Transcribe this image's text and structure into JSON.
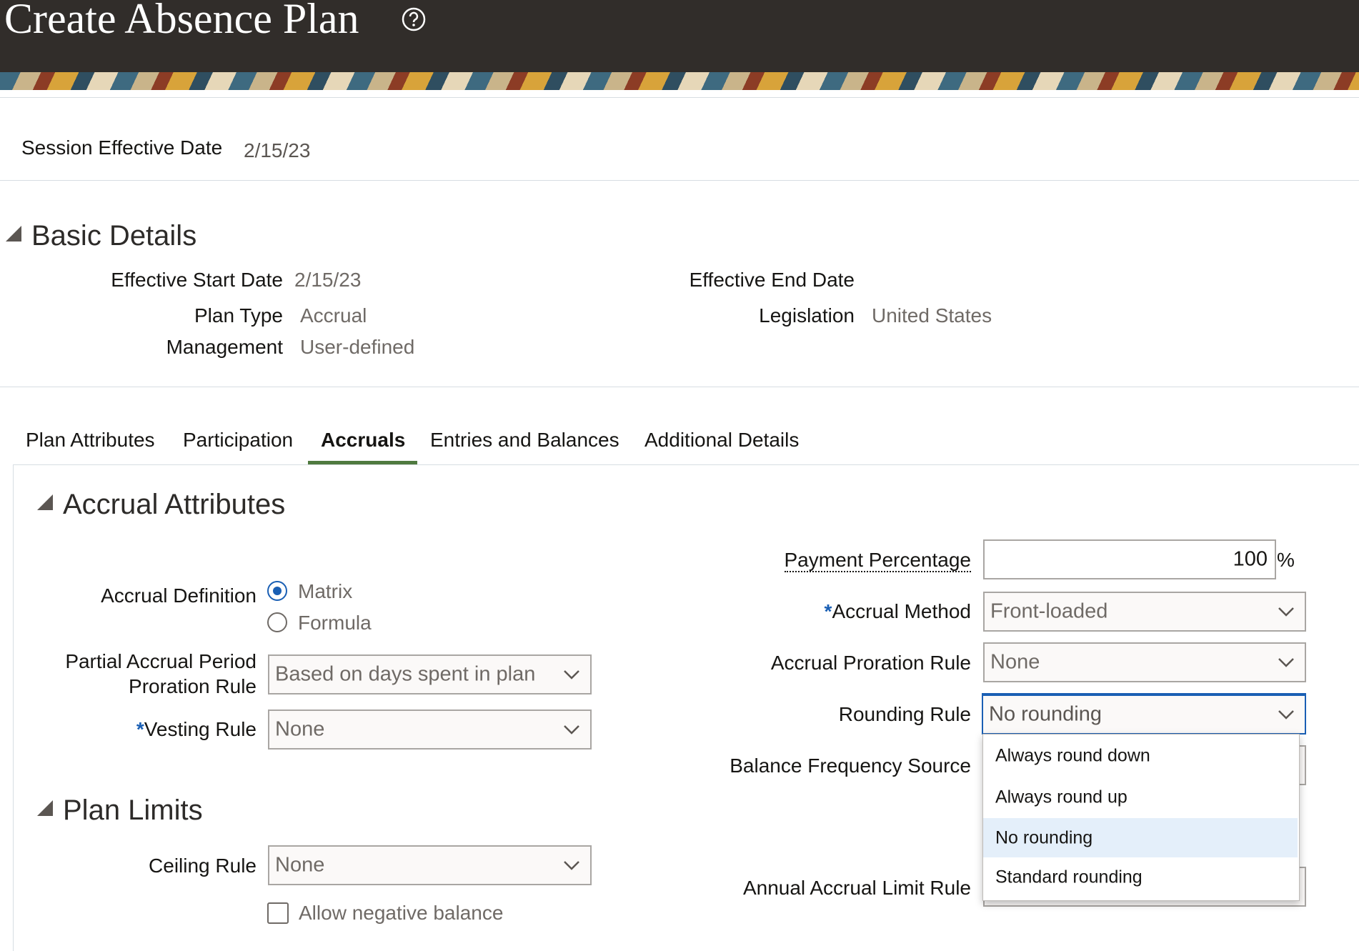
{
  "header": {
    "title": "Create Absence Plan",
    "help_icon": "question-circle-icon"
  },
  "session": {
    "label": "Session Effective Date",
    "value": "2/15/23"
  },
  "basic_details": {
    "title": "Basic Details",
    "effective_start_label": "Effective Start Date",
    "effective_start_value": "2/15/23",
    "plan_type_label": "Plan Type",
    "plan_type_value": "Accrual",
    "management_label": "Management",
    "management_value": "User-defined",
    "effective_end_label": "Effective End Date",
    "legislation_label": "Legislation",
    "legislation_value": "United States"
  },
  "tabs": [
    {
      "label": "Plan Attributes"
    },
    {
      "label": "Participation"
    },
    {
      "label": "Accruals",
      "active": true
    },
    {
      "label": "Entries and Balances"
    },
    {
      "label": "Additional Details"
    }
  ],
  "accrual_attributes": {
    "title": "Accrual Attributes",
    "accrual_definition_label": "Accrual Definition",
    "accrual_definition_options": [
      "Matrix",
      "Formula"
    ],
    "accrual_definition_selected": "Matrix",
    "partial_accrual_label_line1": "Partial Accrual Period",
    "partial_accrual_label_line2": "Proration Rule",
    "partial_accrual_value": "Based on days spent in plan",
    "vesting_rule_label": "Vesting Rule",
    "vesting_rule_value": "None",
    "required_marker": "*",
    "payment_percentage_label": "Payment Percentage",
    "payment_percentage_value": "100",
    "payment_percentage_unit": "%",
    "accrual_method_label": "Accrual Method",
    "accrual_method_value": "Front-loaded",
    "accrual_proration_label": "Accrual Proration Rule",
    "accrual_proration_value": "None",
    "rounding_rule_label": "Rounding Rule",
    "rounding_rule_value": "No rounding",
    "balance_frequency_label": "Balance Frequency Source",
    "annual_accrual_limit_label": "Annual Accrual Limit Rule"
  },
  "rounding_dropdown": {
    "options": [
      "Always round down",
      "Always round up",
      "No rounding",
      "Standard rounding"
    ],
    "selected": "No rounding"
  },
  "plan_limits": {
    "title": "Plan Limits",
    "ceiling_rule_label": "Ceiling Rule",
    "ceiling_rule_value": "None",
    "allow_negative_label": "Allow negative balance",
    "allow_negative_checked": false
  },
  "colors": {
    "header_bg": "#312d2a",
    "active_tab": "#4f7a3f",
    "accent": "#1a5fb4",
    "selected_option_bg": "#e4effa"
  }
}
